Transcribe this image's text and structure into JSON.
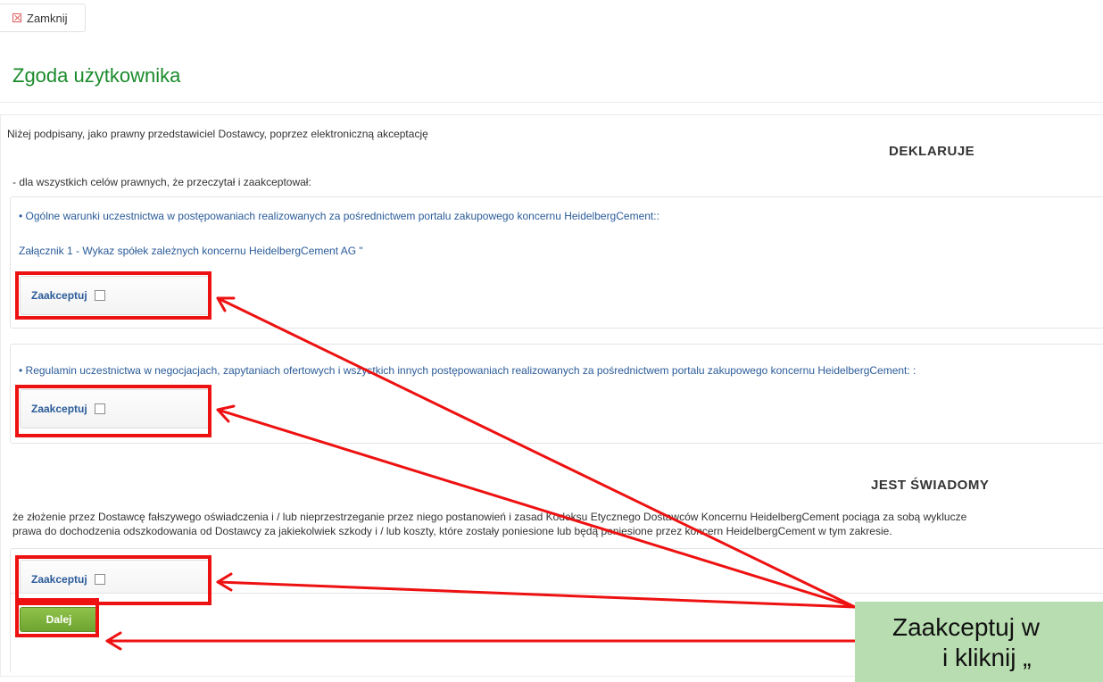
{
  "toolbar": {
    "close_label": "Zamknij"
  },
  "page": {
    "title": "Zgoda użytkownika"
  },
  "content": {
    "intro": "Niżej podpisany, jako prawny przedstawiciel Dostawcy, poprzez elektroniczną akceptację",
    "declares_heading": "DEKLARUJE",
    "declares_text": "- dla wszystkich celów prawnych, że przeczytał i zaakceptował:",
    "section1": {
      "link1": "• Ogólne warunki uczestnictwa w postępowaniach realizowanych za pośrednictwem portalu zakupowego koncernu HeidelbergCement::",
      "link2": "Załącznik 1 - Wykaz spółek zależnych koncernu HeidelbergCement AG \"",
      "accept_label": "Zaakceptuj",
      "accepted": false
    },
    "section2": {
      "link1": "• Regulamin uczestnictwa w negocjacjach, zapytaniach ofertowych i wszystkich innych postępowaniach realizowanych za pośrednictwem portalu zakupowego koncernu HeidelbergCement: :",
      "accept_label": "Zaakceptuj",
      "accepted": false
    },
    "aware_heading": "JEST ŚWIADOMY",
    "aware_line1": "że złożenie przez Dostawcę fałszywego oświadczenia i / lub nieprzestrzeganie przez niego postanowień i zasad Kodeksu Etycznego Dostawców Koncernu HeidelbergCement pociąga za sobą wyklucze",
    "aware_line2": "prawa do dochodzenia odszkodowania od Dostawcy za jakiekolwiek szkody i / lub koszty, które zostały poniesione lub będą poniesione przez koncern HeidelbergCement w tym zakresie.",
    "section3": {
      "accept_label": "Zaakceptuj",
      "accepted": false
    },
    "next_label": "Dalej"
  },
  "annotation": {
    "callout_line1": "Zaakceptuj w",
    "callout_line2": "i kliknij „",
    "highlight_color": "#ee1111",
    "callout_color": "#b8ddb0"
  }
}
